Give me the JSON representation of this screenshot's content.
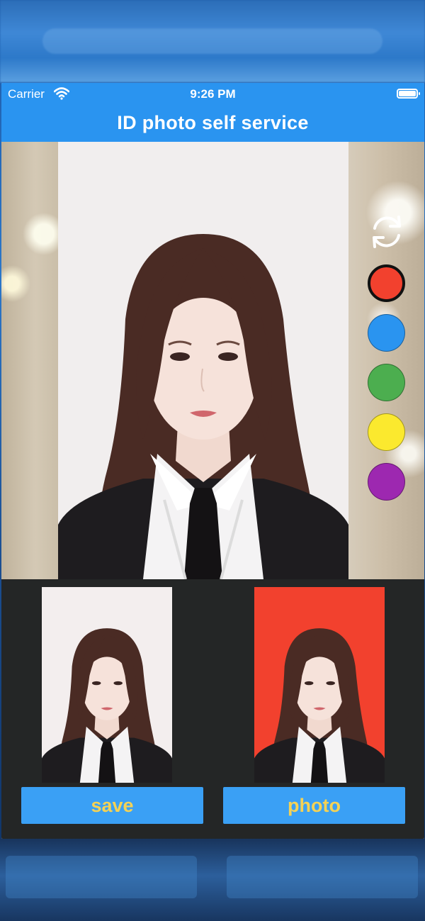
{
  "status_bar": {
    "carrier": "Carrier",
    "time": "9:26 PM",
    "wifi_icon": "wifi-icon",
    "battery_icon": "battery-icon"
  },
  "nav": {
    "title": "ID photo self service"
  },
  "editor": {
    "rotate_icon": "rotate-icon",
    "colors": [
      {
        "name": "red",
        "hex": "#f2412e",
        "selected": true
      },
      {
        "name": "blue",
        "hex": "#2a94f0",
        "selected": false
      },
      {
        "name": "green",
        "hex": "#4cae4f",
        "selected": false
      },
      {
        "name": "yellow",
        "hex": "#fbe92e",
        "selected": false
      },
      {
        "name": "purple",
        "hex": "#9d28b0",
        "selected": false
      }
    ]
  },
  "preview": {
    "original_background": "#f3eeee",
    "result_background": "#f2412e"
  },
  "actions": {
    "save_label": "save",
    "photo_label": "photo"
  },
  "theme": {
    "primary": "#2a94f0",
    "button_text": "#f4d255",
    "panel": "#242626"
  }
}
